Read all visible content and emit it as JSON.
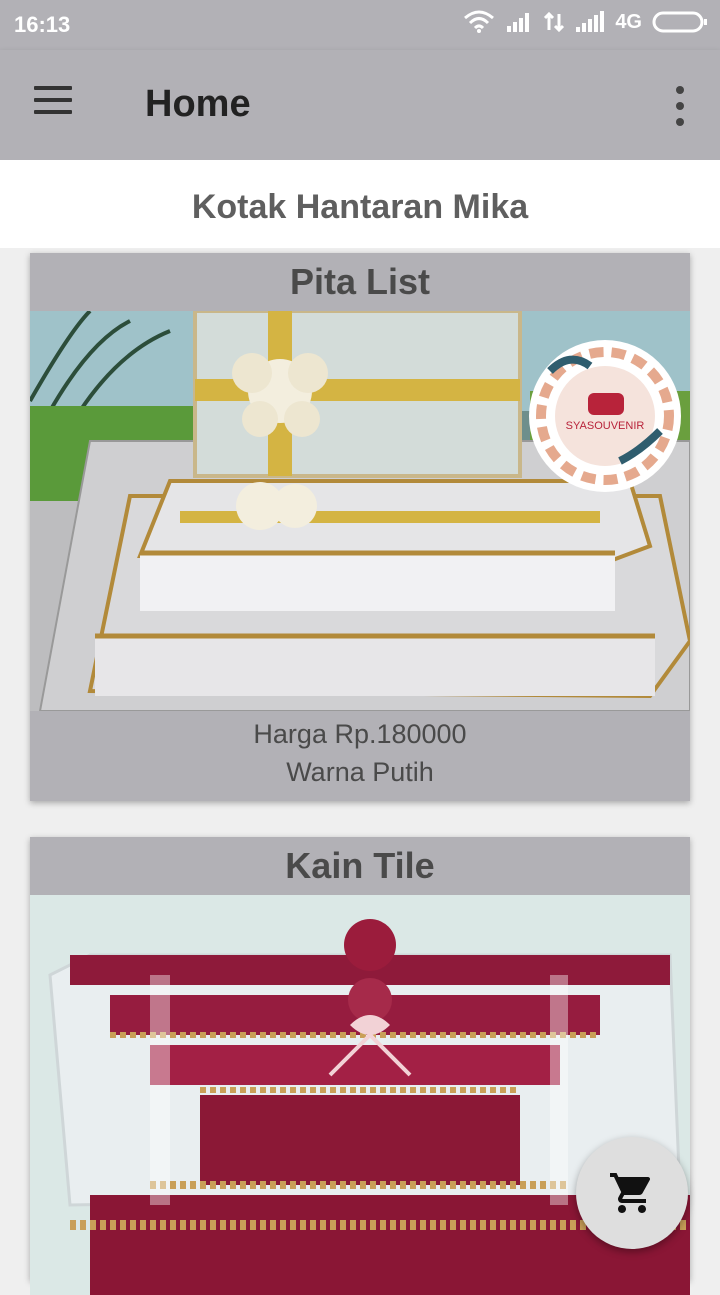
{
  "status_bar": {
    "time": "16:13",
    "network": "4G"
  },
  "app_bar": {
    "title": "Home"
  },
  "section": {
    "title": "Kotak Hantaran Mika"
  },
  "products": [
    {
      "title": "Pita List",
      "price": "Harga Rp.180000",
      "color": "Warna Putih",
      "logo_text": "SYASOUVENIR"
    },
    {
      "title": "Kain Tile"
    }
  ],
  "icons": {
    "menu": "hamburger-menu-icon",
    "more": "more-vert-icon",
    "cart": "shopping-cart-icon",
    "wifi": "wifi-icon",
    "signal": "signal-icon",
    "battery": "battery-icon"
  },
  "colors": {
    "app_bar": "#b2b1b6",
    "card": "#b2b1b6",
    "fab": "#dedede"
  }
}
